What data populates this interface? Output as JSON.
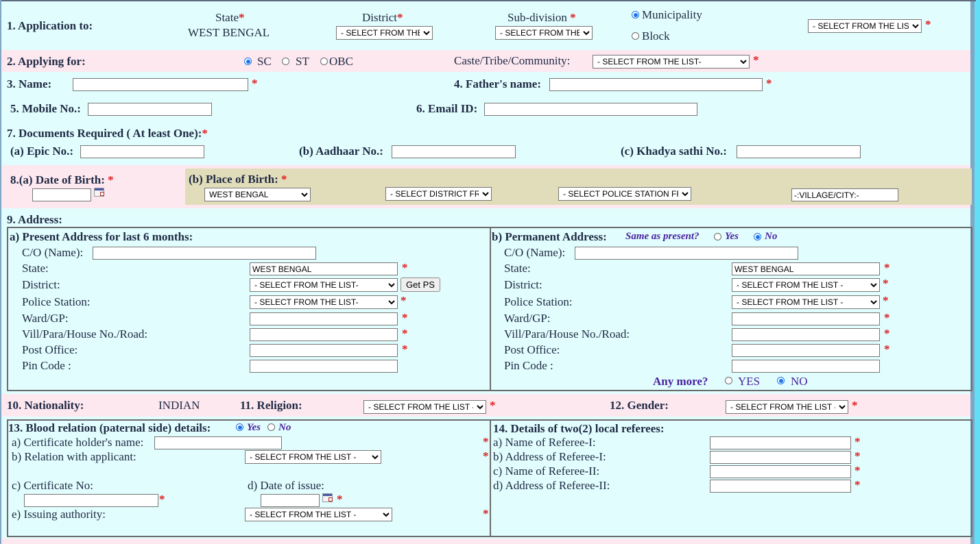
{
  "app_to": {
    "label": "1. Application to:",
    "state_label": "State",
    "state_value": "WEST BENGAL",
    "district_label": "District",
    "district_select": "- SELECT FROM THE LIST-",
    "subdivision_label": "Sub-division",
    "subdivision_select": "- SELECT FROM THE LIST-",
    "municipality_label": "Municipality",
    "block_label": "Block",
    "municipality_selected": true,
    "local_body_select": "- SELECT FROM THE LIST-"
  },
  "applying_for": {
    "label": "2. Applying for:",
    "options": [
      "SC",
      "ST",
      "OBC"
    ],
    "selected": "SC",
    "caste_label": "Caste/Tribe/Community:",
    "caste_select": "- SELECT FROM THE LIST-"
  },
  "name": {
    "label": "3. Name:",
    "value": ""
  },
  "father": {
    "label": "4. Father's name:",
    "value": ""
  },
  "mobile": {
    "label": "5. Mobile No.:",
    "value": ""
  },
  "email": {
    "label": "6. Email ID:",
    "value": ""
  },
  "documents": {
    "label": "7. Documents Required ( At least One):",
    "epic_label": "(a) Epic No.:",
    "aadhaar_label": "(b) Aadhaar No.:",
    "khadya_label": "(c) Khadya sathi No.:"
  },
  "dob": {
    "label": "8.(a) Date of Birth:",
    "value": ""
  },
  "pob": {
    "label": "(b) Place of Birth:",
    "state_select": "WEST BENGAL",
    "district_select": "- SELECT DISTRICT FROM THE LIST-",
    "ps_select": "- SELECT POLICE STATION FROM THE LIST-",
    "village_value": "-:VILLAGE/CITY:-"
  },
  "address": {
    "label": "9. Address:",
    "present": {
      "title": "a) Present Address for last 6 months:",
      "co_label": "C/O (Name):",
      "state_label": "State:",
      "state_value": "WEST BENGAL",
      "district_label": "District:",
      "district_select": "- SELECT FROM THE LIST-",
      "get_ps": "Get PS",
      "ps_label": "Police Station:",
      "ps_select": "- SELECT FROM THE LIST-",
      "ward_label": "Ward/GP:",
      "vill_label": "Vill/Para/House No./Road:",
      "po_label": "Post Office:",
      "pin_label": "Pin Code :"
    },
    "permanent": {
      "title": "b) Permanent Address:",
      "same_label": "Same as present?",
      "same_yes": "Yes",
      "same_no": "No",
      "same_selected": "No",
      "co_label": "C/O (Name):",
      "state_label": "State:",
      "state_value": "WEST BENGAL",
      "district_label": "District:",
      "district_select": "- SELECT FROM THE LIST -",
      "ps_label": "Police Station:",
      "ps_select": "- SELECT FROM THE LIST -",
      "ward_label": "Ward/GP:",
      "vill_label": "Vill/Para/House No./Road:",
      "po_label": "Post Office:",
      "pin_label": "Pin Code :",
      "any_more_label": "Any more?",
      "any_yes": "YES",
      "any_no": "NO",
      "any_selected": "NO"
    }
  },
  "nationality": {
    "label": "10. Nationality:",
    "value": "INDIAN"
  },
  "religion": {
    "label": "11. Religion:",
    "select": "- SELECT FROM THE LIST -"
  },
  "gender": {
    "label": "12. Gender:",
    "select": "- SELECT FROM THE LIST -"
  },
  "blood": {
    "title": "13. Blood relation (paternal side) details:",
    "yes": "Yes",
    "no": "No",
    "selected": "Yes",
    "holder_label": "a) Certificate holder's name:",
    "relation_label": "b) Relation with applicant:",
    "relation_select": "- SELECT FROM THE LIST -",
    "cert_label": "c) Certificate No:",
    "date_label": "d) Date of issue:",
    "authority_label": "e) Issuing authority:",
    "authority_select": "- SELECT FROM THE LIST -"
  },
  "referees": {
    "title": "14. Details of two(2) local referees:",
    "items": [
      "a) Name of Referee-I:",
      "b) Address of Referee-I:",
      "c) Name of Referee-II:",
      "d) Address of Referee-II:"
    ]
  },
  "required_mark": "*"
}
